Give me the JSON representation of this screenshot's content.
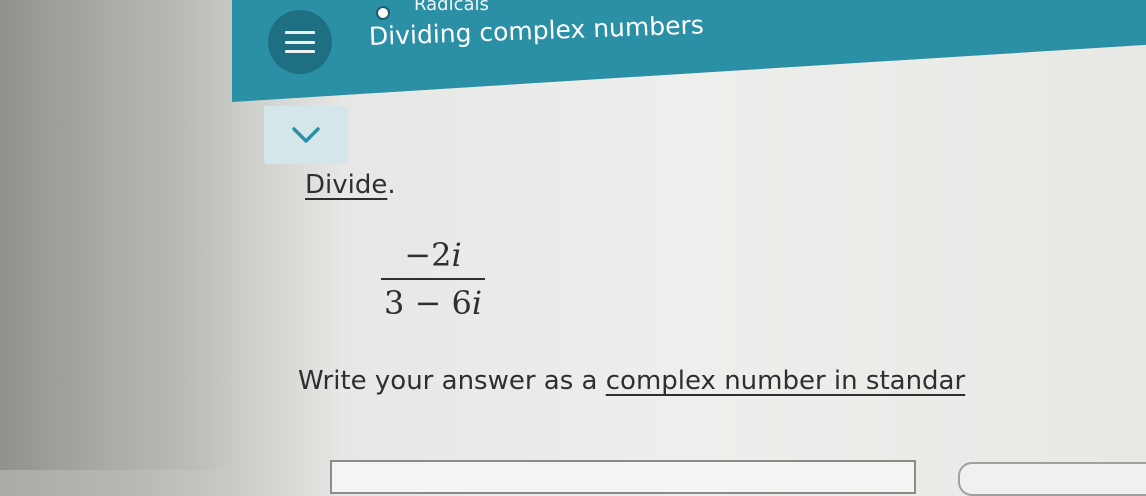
{
  "header": {
    "topic_label": "Radicals",
    "title": "Dividing complex numbers",
    "menu_icon": "hamburger-menu-icon",
    "topic_icon": "radio-dot-icon"
  },
  "problem": {
    "instruction": "Divide",
    "instruction_period": ".",
    "numerator": "−2",
    "numerator_i": "i",
    "denominator": "3 − 6",
    "denominator_i": "i",
    "answer_prompt_prefix": "Write your answer as a ",
    "answer_prompt_link": "complex number in standar"
  },
  "controls": {
    "expand_icon": "chevron-down-icon"
  },
  "colors": {
    "header": "#2b8fa6",
    "menu_button": "#1f6f82",
    "expand_button": "#d4e6ea",
    "text": "#2e3030"
  }
}
